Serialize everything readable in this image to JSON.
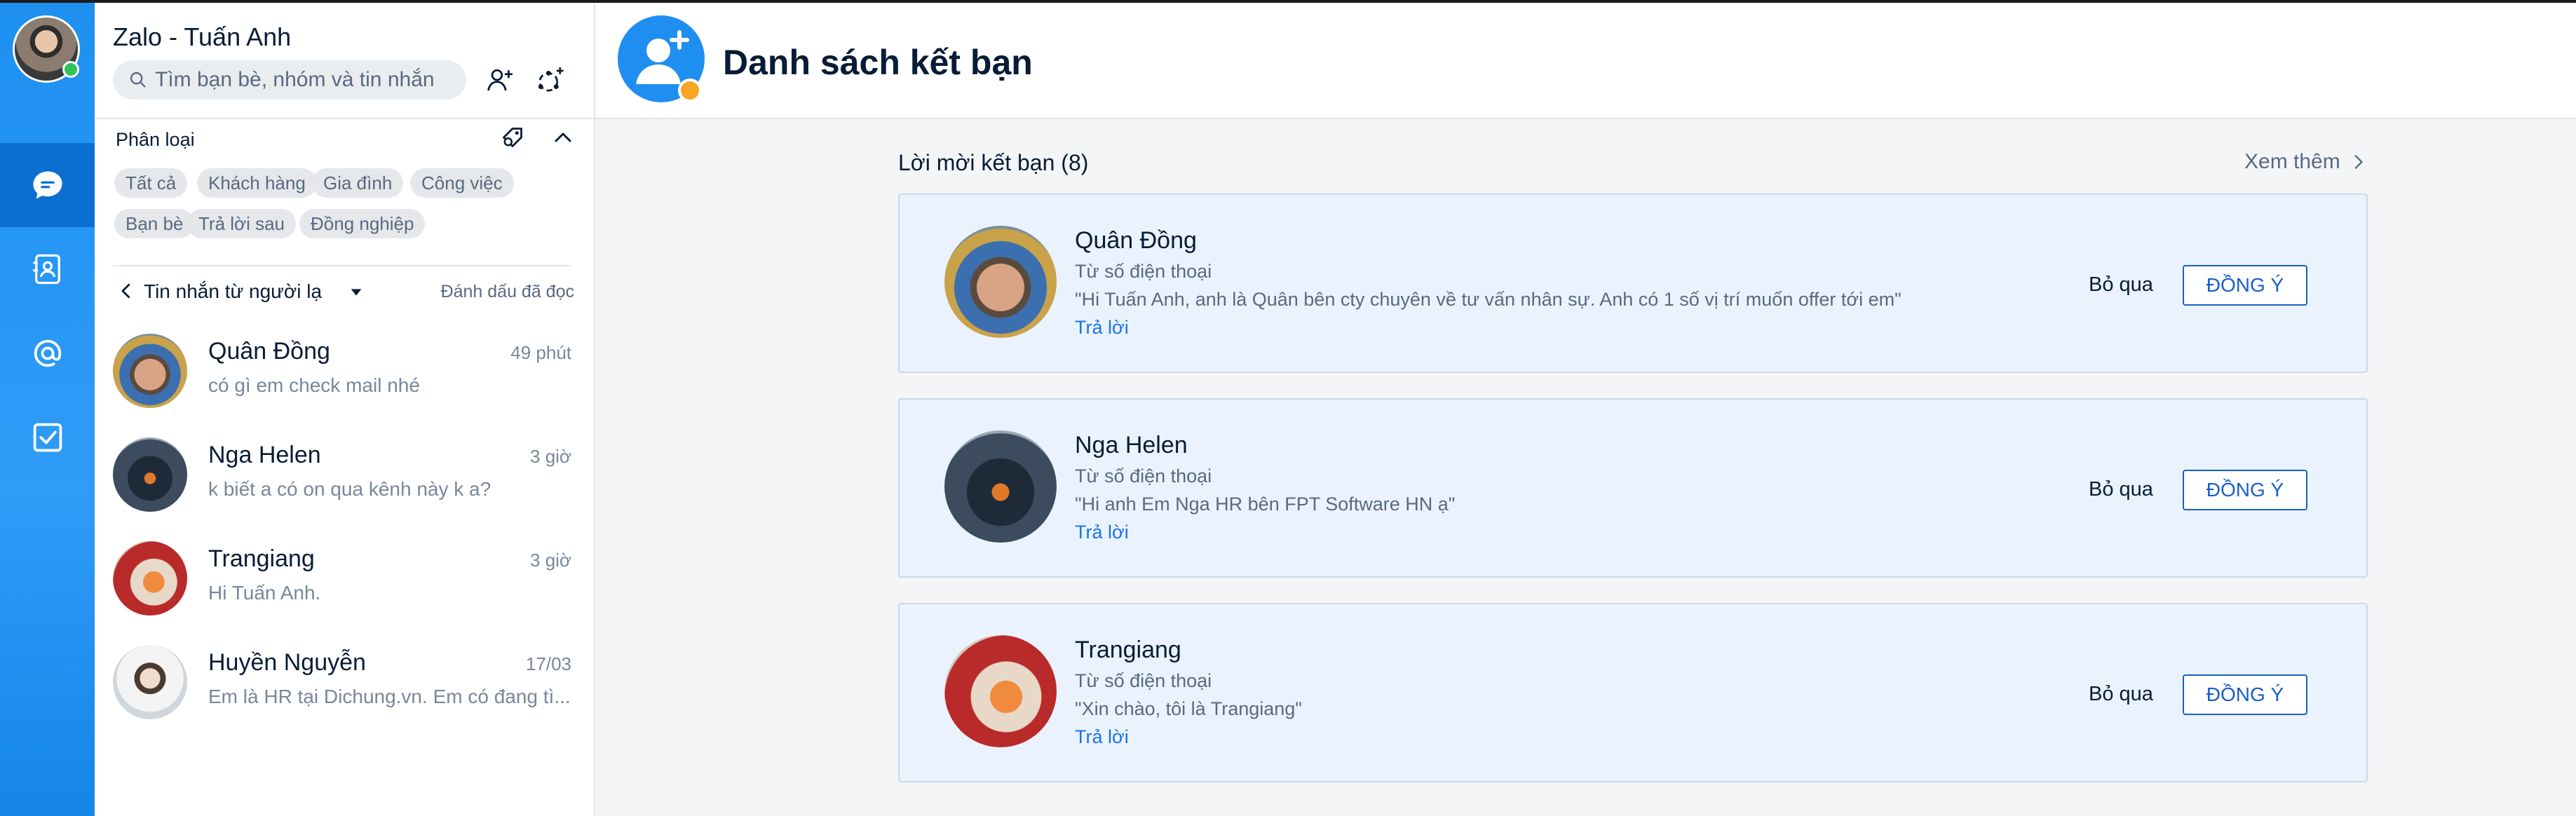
{
  "app": {
    "title": "Zalo - Tuấn Anh"
  },
  "search": {
    "placeholder": "Tìm bạn bè, nhóm và tin nhắn",
    "value": ""
  },
  "nav": {
    "items": [
      "chat-icon",
      "contacts-icon",
      "mention-icon",
      "todo-icon"
    ],
    "active": "chat-icon"
  },
  "filter": {
    "heading": "Phân loại",
    "chips": [
      "Tất cả",
      "Khách hàng",
      "Gia đình",
      "Công việc",
      "Bạn bè",
      "Trả lời sau",
      "Đồng nghiệp"
    ]
  },
  "stranger": {
    "label": "Tin nhắn từ người lạ",
    "mark_read": "Đánh dấu đã đọc"
  },
  "conversations": [
    {
      "name": "Quân Đồng",
      "time": "49 phút",
      "message": "có gì em check mail nhé"
    },
    {
      "name": "Nga Helen",
      "time": "3 giờ",
      "message": "k biết a có on qua kênh này k a?"
    },
    {
      "name": "Trangiang",
      "time": "3 giờ",
      "message": "Hi Tuấn Anh."
    },
    {
      "name": "Huyền Nguyễn",
      "time": "17/03",
      "message": "Em là HR tại Dichung.vn. Em có đang tì..."
    }
  ],
  "main": {
    "title": "Danh sách kết bạn",
    "section_title": "Lời mời kết bạn (8)",
    "see_more": "Xem thêm",
    "requests": [
      {
        "name": "Quân Đồng",
        "source": "Từ số điện thoại",
        "message": "\"Hi Tuấn Anh, anh là Quân bên cty chuyên về tư vấn nhân sự. Anh có 1 số vị trí muốn offer tới em\"",
        "reply": "Trả lời",
        "skip": "Bỏ qua",
        "accept": "ĐỒNG Ý"
      },
      {
        "name": "Nga Helen",
        "source": "Từ số điện thoại",
        "message": "\"Hi anh Em Nga HR bên FPT Software HN ạ\"",
        "reply": "Trả lời",
        "skip": "Bỏ qua",
        "accept": "ĐỒNG Ý"
      },
      {
        "name": "Trangiang",
        "source": "Từ số điện thoại",
        "message": "\"Xin chào, tôi là Trangiang\"",
        "reply": "Trả lời",
        "skip": "Bỏ qua",
        "accept": "ĐỒNG Ý"
      }
    ]
  },
  "colors": {
    "brand": "#1f8ef1",
    "rail_active": "#0a6fd1",
    "link": "#1a73e8",
    "accept_border": "#1a5fc7",
    "card_bg": "#eaf3fd"
  }
}
